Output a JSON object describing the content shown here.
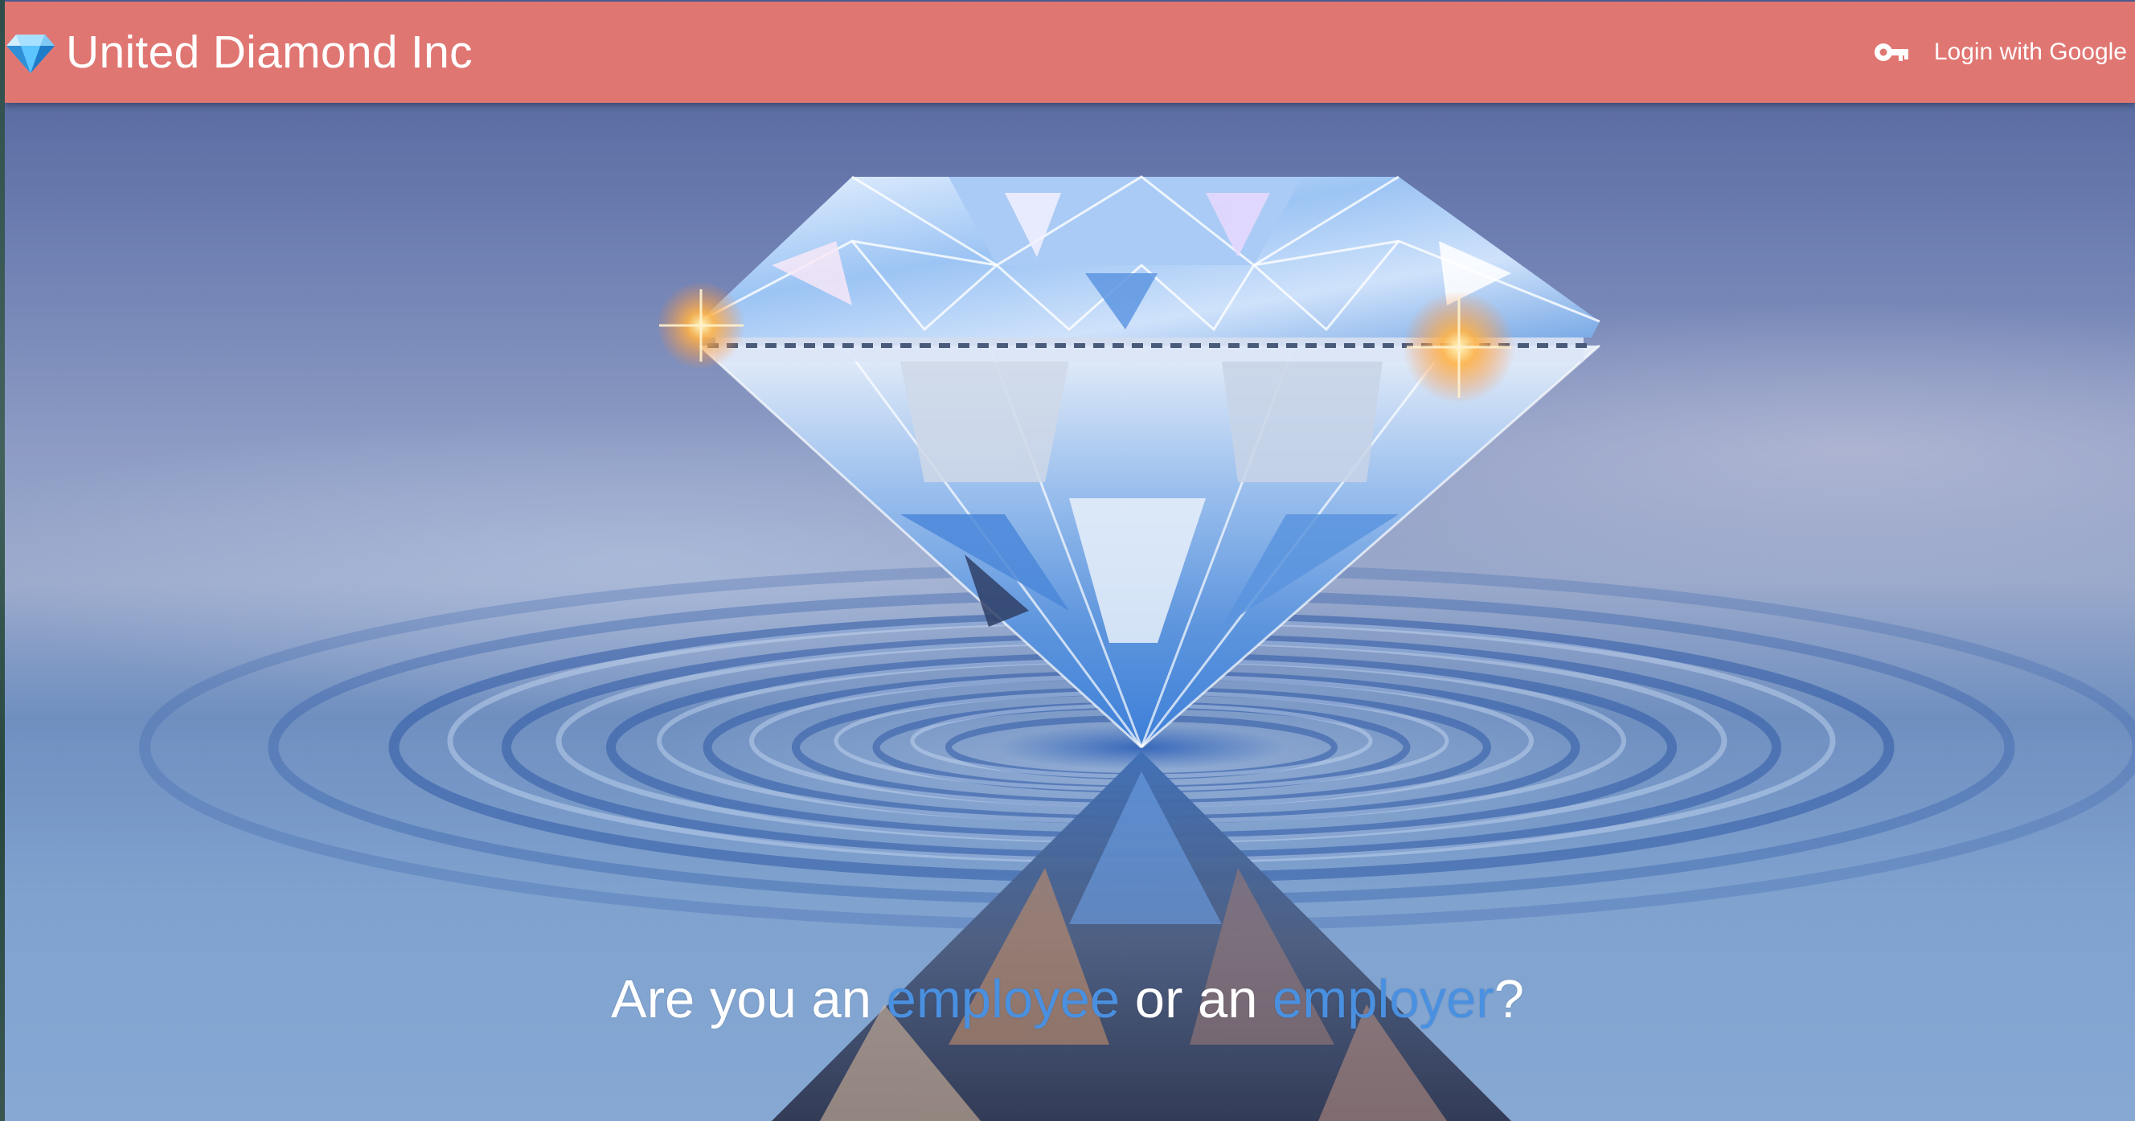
{
  "navbar": {
    "brand_name": "United Diamond Inc",
    "brand_icon": "gem-icon",
    "login_label": "Login with Google",
    "login_icon": "key-icon",
    "background_color": "#e07672"
  },
  "hero": {
    "image": "diamond-on-water-photo",
    "question": {
      "prefix": "Are you an ",
      "employee_link": "employee",
      "middle": " or an ",
      "employer_link": "employer",
      "suffix": "?"
    },
    "link_color": "#4a90e0"
  }
}
